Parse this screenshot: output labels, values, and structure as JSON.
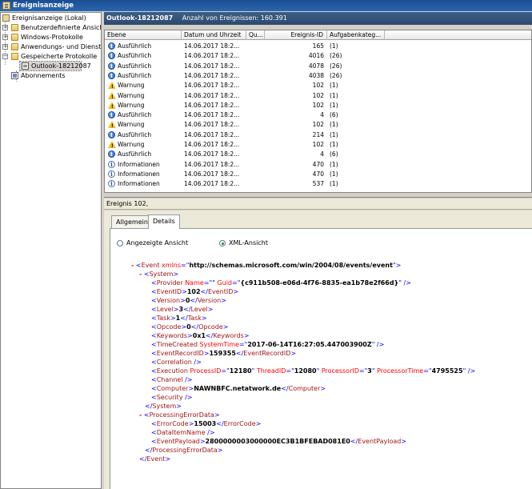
{
  "window": {
    "title": "Ereignisanzeige"
  },
  "tree": {
    "items": [
      {
        "label": "Ereignisanzeige (Lokal)"
      },
      {
        "label": "Benutzerdefinierte Ansichten"
      },
      {
        "label": "Windows-Protokolle"
      },
      {
        "label": "Anwendungs- und Dienstprotokolle"
      },
      {
        "label": "Gespeicherte Protokolle"
      },
      {
        "label": "Outlook-18212087"
      },
      {
        "label": "Abonnements"
      }
    ]
  },
  "log_header": {
    "name": "Outlook-18212087",
    "count": "Anzahl von Ereignissen: 160.391"
  },
  "table": {
    "columns": [
      "Ebene",
      "Datum und Uhrzeit",
      "Qu...",
      "Ereignis-ID",
      "Aufgabenkateg..."
    ],
    "rows": [
      {
        "icon": "info-blue",
        "level": "Ausführlich",
        "datetime": "14.06.2017 18:2...",
        "source": "",
        "event_id": "165",
        "task": "(1)"
      },
      {
        "icon": "info-blue",
        "level": "Ausführlich",
        "datetime": "14.06.2017 18:2...",
        "source": "",
        "event_id": "4016",
        "task": "(26)"
      },
      {
        "icon": "info-blue",
        "level": "Ausführlich",
        "datetime": "14.06.2017 18:2...",
        "source": "",
        "event_id": "4078",
        "task": "(26)"
      },
      {
        "icon": "info-blue",
        "level": "Ausführlich",
        "datetime": "14.06.2017 18:2...",
        "source": "",
        "event_id": "4038",
        "task": "(26)"
      },
      {
        "icon": "warn",
        "level": "Warnung",
        "datetime": "14.06.2017 18:2...",
        "source": "",
        "event_id": "102",
        "task": "(1)"
      },
      {
        "icon": "warn",
        "level": "Warnung",
        "datetime": "14.06.2017 18:2...",
        "source": "",
        "event_id": "102",
        "task": "(1)"
      },
      {
        "icon": "warn",
        "level": "Warnung",
        "datetime": "14.06.2017 18:2...",
        "source": "",
        "event_id": "102",
        "task": "(1)"
      },
      {
        "icon": "info-blue",
        "level": "Ausführlich",
        "datetime": "14.06.2017 18:2...",
        "source": "",
        "event_id": "4",
        "task": "(6)"
      },
      {
        "icon": "warn",
        "level": "Warnung",
        "datetime": "14.06.2017 18:2...",
        "source": "",
        "event_id": "102",
        "task": "(1)"
      },
      {
        "icon": "info-blue",
        "level": "Ausführlich",
        "datetime": "14.06.2017 18:2...",
        "source": "",
        "event_id": "214",
        "task": "(1)"
      },
      {
        "icon": "warn",
        "level": "Warnung",
        "datetime": "14.06.2017 18:2...",
        "source": "",
        "event_id": "102",
        "task": "(1)"
      },
      {
        "icon": "info-blue",
        "level": "Ausführlich",
        "datetime": "14.06.2017 18:2...",
        "source": "",
        "event_id": "4",
        "task": "(6)"
      },
      {
        "icon": "info-white",
        "level": "Informationen",
        "datetime": "14.06.2017 18:2...",
        "source": "",
        "event_id": "470",
        "task": "(1)"
      },
      {
        "icon": "info-white",
        "level": "Informationen",
        "datetime": "14.06.2017 18:2...",
        "source": "",
        "event_id": "470",
        "task": "(1)"
      },
      {
        "icon": "info-white",
        "level": "Informationen",
        "datetime": "14.06.2017 18:2...",
        "source": "",
        "event_id": "537",
        "task": "(1)"
      }
    ]
  },
  "detail": {
    "header": "Ereignis 102,",
    "tabs": [
      "Allgemein",
      "Details"
    ],
    "radio_friendly": "Angezeigte Ansicht",
    "radio_xml": "XML-Ansicht",
    "xml": {
      "event_ns": "http://schemas.microsoft.com/win/2004/08/events/event",
      "provider_name": "",
      "provider_guid": "{c911b508-e06d-4f76-8835-ea1b78e2f66d}",
      "event_id": "102",
      "version": "0",
      "level": "3",
      "task": "1",
      "opcode": "0",
      "keywords": "0x1",
      "time_created": "2017-06-14T16:27:05.447003900Z",
      "event_record_id": "159355",
      "process_id": "12180",
      "thread_id": "12080",
      "processor_id": "3",
      "processor_time": "4795525",
      "computer": "NAWNBFC.netatwork.de",
      "error_code": "15003",
      "event_payload": "2800000003000000EC3B1BFEBAD081E0"
    }
  }
}
